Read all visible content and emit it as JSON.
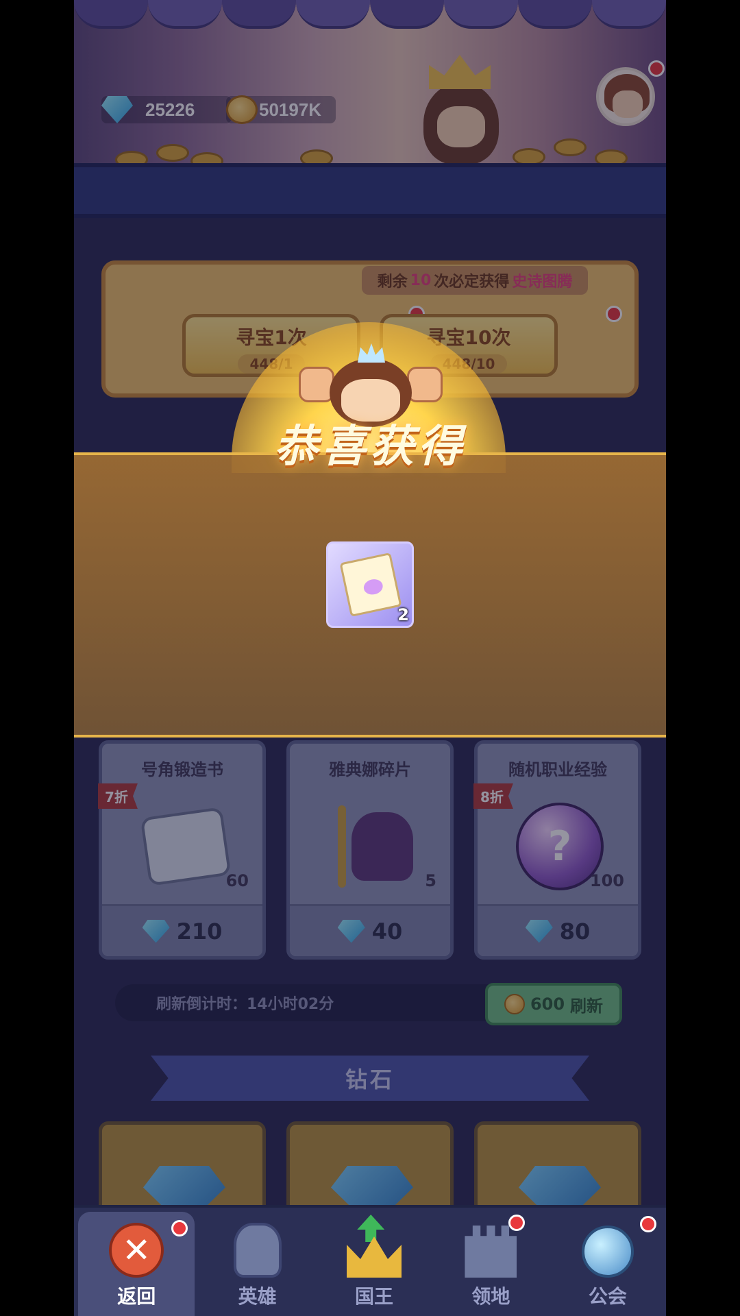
{
  "header": {
    "gems": "25226",
    "gold": "50197K"
  },
  "treasure": {
    "remain_prefix": "剩余",
    "remain_count": "10",
    "remain_suffix": "次必定获得",
    "remain_reward": "史诗图腾",
    "single_label": "寻宝1次",
    "single_cost": "448/1",
    "ten_label": "寻宝10次",
    "ten_cost": "448/10"
  },
  "popup": {
    "title": "恭喜获得",
    "item_icon": "integral-scroll-icon",
    "item_qty": "2"
  },
  "shop": {
    "items": [
      {
        "name": "号角锻造书",
        "discount": "7折",
        "count": "60",
        "price": "210"
      },
      {
        "name": "雅典娜碎片",
        "discount": "",
        "count": "5",
        "price": "40"
      },
      {
        "name": "随机职业经验",
        "discount": "8折",
        "count": "100",
        "price": "80"
      }
    ],
    "refresh_countdown": "刷新倒计时：14小时02分",
    "refresh_cost": "600",
    "refresh_label": "刷新"
  },
  "section_title": "钻石",
  "nav": [
    {
      "label": "返回",
      "icon": "close-icon"
    },
    {
      "label": "英雄",
      "icon": "helmet-icon"
    },
    {
      "label": "国王",
      "icon": "crown-icon"
    },
    {
      "label": "领地",
      "icon": "castle-icon"
    },
    {
      "label": "公会",
      "icon": "planet-icon"
    }
  ],
  "colors": {
    "accent_gold": "#f3c24b",
    "notify_red": "#e8383c",
    "refresh_green": "#6fbf84",
    "nav_bg": "#2b2f55"
  }
}
